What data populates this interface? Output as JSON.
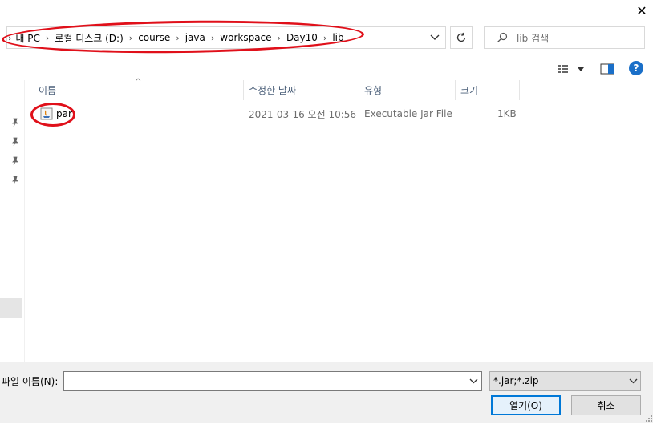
{
  "window": {
    "close_glyph": "✕"
  },
  "address_bar": {
    "crumbs": [
      "내 PC",
      "로컬 디스크 (D:)",
      "course",
      "java",
      "workspace",
      "Day10",
      "lib"
    ],
    "separator_icon": "chevron-right-icon",
    "dropdown_icon": "chevron-down-icon",
    "refresh_icon": "refresh-icon"
  },
  "search": {
    "placeholder": "lib 검색",
    "icon": "search-icon"
  },
  "toolbar": {
    "view_icon": "view-options-icon",
    "preview_pane_icon": "preview-pane-icon",
    "help_glyph": "?"
  },
  "columns": {
    "name": "이름",
    "date": "수정한 날짜",
    "type": "유형",
    "size": "크기"
  },
  "files": [
    {
      "name": "par",
      "date": "2021-03-16 오전 10:56",
      "type": "Executable Jar File",
      "size": "1KB",
      "icon": "jar-file-icon"
    }
  ],
  "bottom": {
    "filename_label": "파일 이름(N):",
    "filename_value": "",
    "filter_value": "*.jar;*.zip",
    "open_label": "열기(O)",
    "cancel_label": "취소"
  },
  "colors": {
    "annotation": "#e0101a",
    "accent": "#0078d7",
    "header_text": "#4c607a"
  }
}
